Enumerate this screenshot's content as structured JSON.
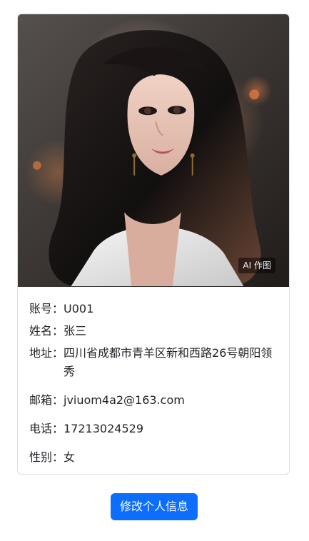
{
  "profile": {
    "photo_label": "AI 作图",
    "fields": [
      {
        "label": "账号：",
        "value": "U001"
      },
      {
        "label": "姓名：",
        "value": "张三"
      },
      {
        "label": "地址：",
        "value": "四川省成都市青羊区新和西路26号朝阳领秀"
      },
      {
        "label": "邮箱：",
        "value": "jviuom4a2@163.com"
      },
      {
        "label": "电话：",
        "value": "17213024529"
      },
      {
        "label": "性别：",
        "value": "女"
      }
    ]
  },
  "actions": {
    "edit_label": "修改个人信息"
  },
  "colors": {
    "button": "#0d6efd",
    "border": "#dcdfe3"
  }
}
